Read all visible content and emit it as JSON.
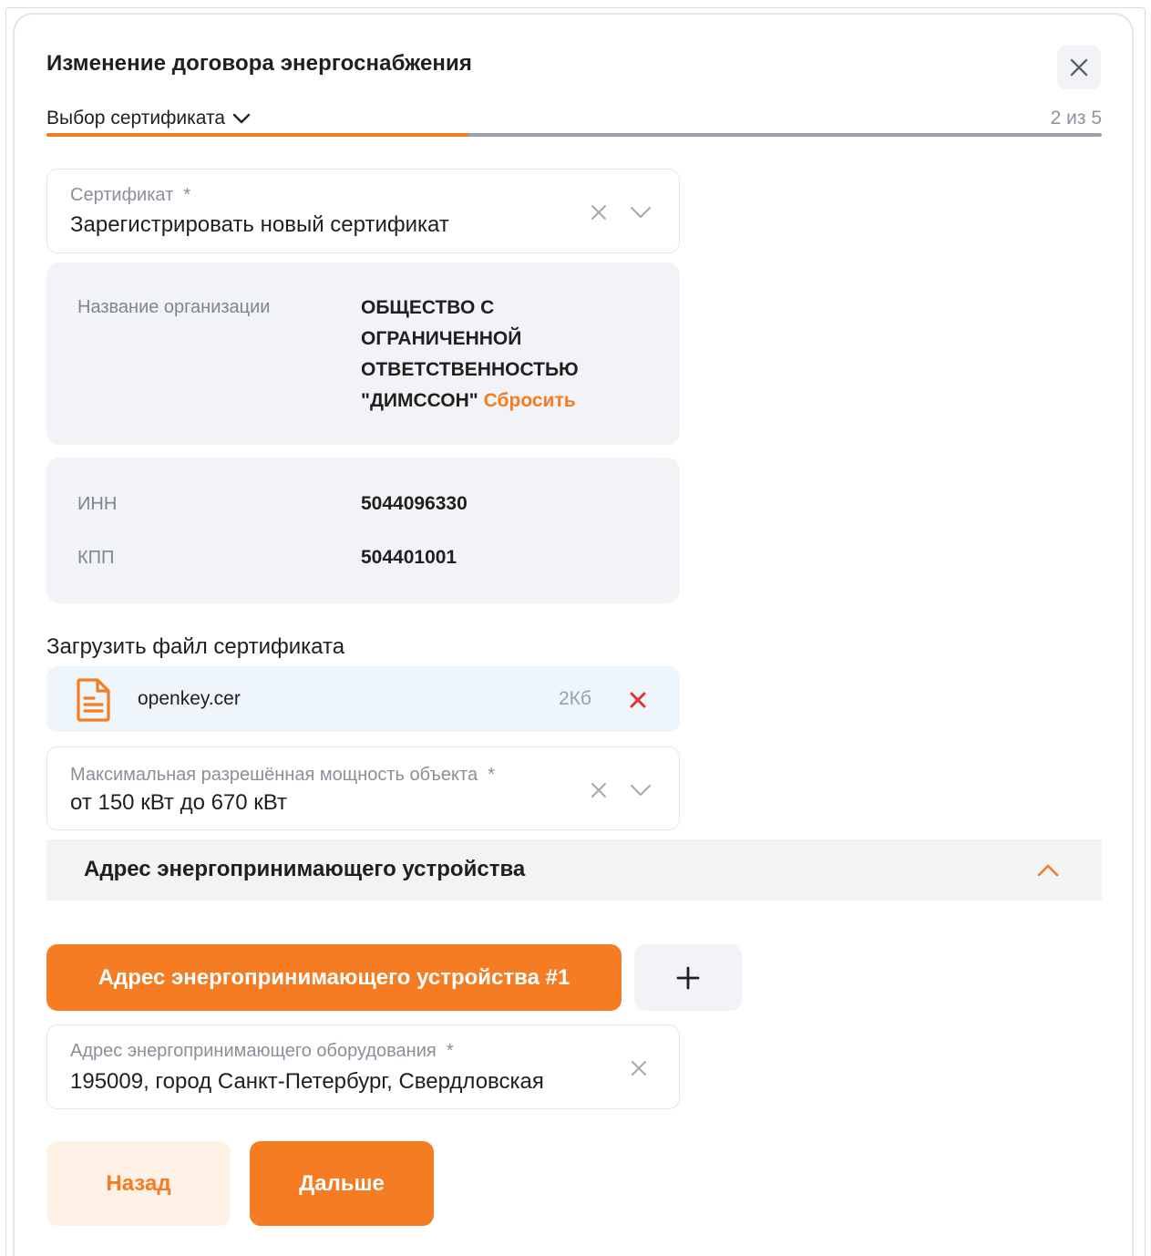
{
  "modal": {
    "title": "Изменение договора энергоснабжения"
  },
  "stepper": {
    "current_step_label": "Выбор сертификата",
    "counter": "2 из 5",
    "progress": 0.4
  },
  "certificate_field": {
    "label": "Сертификат",
    "required_mark": "*",
    "value": "Зарегистрировать новый сертификат"
  },
  "organization": {
    "key": "Название организации",
    "value_lines": [
      "ОБЩЕСТВО С",
      "ОГРАНИЧЕННОЙ",
      "ОТВЕТСТВЕННОСТЬЮ",
      "\"ДИМССОН\""
    ],
    "reset_label": "Сбросить"
  },
  "requisites": {
    "inn_key": "ИНН",
    "inn_value": "5044096330",
    "kpp_key": "КПП",
    "kpp_value": "504401001"
  },
  "upload": {
    "section_label": "Загрузить файл сертификата",
    "file_name": "openkey.cer",
    "file_size": "2Кб"
  },
  "power_field": {
    "label": "Максимальная разрешённая мощность объекта",
    "required_mark": "*",
    "value": "от 150 кВт до 670 кВт"
  },
  "address_section": {
    "title": "Адрес энергопринимающего устройства",
    "tab_label": "Адрес энергопринимающего устройства #1",
    "field_label": "Адрес энергопринимающего оборудования",
    "required_mark": "*",
    "field_value": "195009, город Санкт-Петербург, Свердловская"
  },
  "footer": {
    "back_label": "Назад",
    "next_label": "Дальше"
  },
  "colors": {
    "accent": "#f57c22",
    "accent_light": "#fef1e6",
    "danger": "#e5322d"
  }
}
